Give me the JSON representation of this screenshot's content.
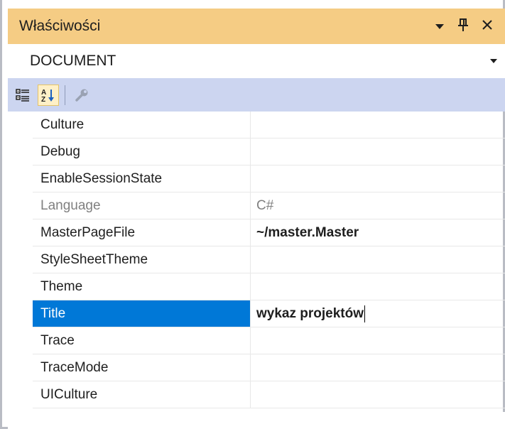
{
  "panel": {
    "title": "Właściwości",
    "dropdown_glyph": "▾",
    "pin_glyph": "ꟼ",
    "close_glyph": "✕"
  },
  "selector": {
    "value": "DOCUMENT"
  },
  "toolbar": {
    "buttons": [
      {
        "name": "categorized-icon",
        "active": false
      },
      {
        "name": "alphabetical-icon",
        "active": true
      },
      {
        "name": "property-pages-icon",
        "active": false
      }
    ]
  },
  "properties": [
    {
      "name": "Culture",
      "value": ""
    },
    {
      "name": "Debug",
      "value": ""
    },
    {
      "name": "EnableSessionState",
      "value": ""
    },
    {
      "name": "Language",
      "value": "C#",
      "readonly": true
    },
    {
      "name": "MasterPageFile",
      "value": "~/master.Master",
      "bold": true
    },
    {
      "name": "StyleSheetTheme",
      "value": ""
    },
    {
      "name": "Theme",
      "value": ""
    },
    {
      "name": "Title",
      "value": "wykaz projektów",
      "bold": true,
      "selected": true
    },
    {
      "name": "Trace",
      "value": ""
    },
    {
      "name": "TraceMode",
      "value": ""
    },
    {
      "name": "UICulture",
      "value": ""
    }
  ],
  "colors": {
    "titlebar": "#f5cc84",
    "toolbar": "#ccd5f0",
    "selection": "#0078d7"
  }
}
